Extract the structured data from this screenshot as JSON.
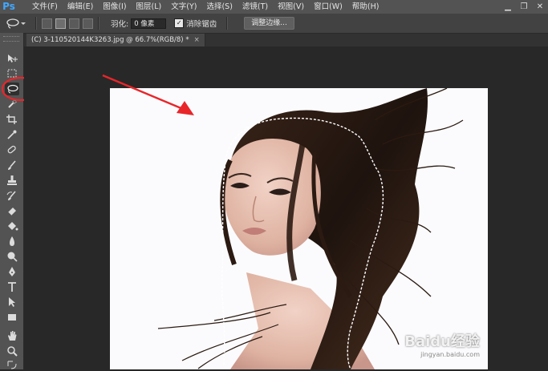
{
  "app": {
    "logo": "Ps"
  },
  "menu": [
    "文件(F)",
    "编辑(E)",
    "图像(I)",
    "图层(L)",
    "文字(Y)",
    "选择(S)",
    "滤镜(T)",
    "视图(V)",
    "窗口(W)",
    "帮助(H)"
  ],
  "options": {
    "feather_label": "羽化:",
    "feather_value": "0 像素",
    "antialias_label": "消除锯齿",
    "antialias_checked": true,
    "refine_button": "调整边缘..."
  },
  "document": {
    "tab_title": "(C) 3-110520144K3263.jpg @ 66.7%(RGB/8) *",
    "close": "×"
  },
  "tools": [
    "move-tool",
    "marquee-tool",
    "lasso-tool",
    "quick-select-tool",
    "crop-tool",
    "eyedropper-tool",
    "spot-heal-tool",
    "brush-tool",
    "clone-stamp-tool",
    "history-brush-tool",
    "eraser-tool",
    "paint-bucket-tool",
    "blur-tool",
    "dodge-tool",
    "pen-tool",
    "type-tool",
    "path-select-tool",
    "rectangle-tool",
    "hand-tool",
    "zoom-tool"
  ],
  "active_tool": "lasso-tool",
  "watermark": {
    "main": "Baidu经验",
    "sub": "jingyan.baidu.com"
  },
  "colors": {
    "accent": "#41a7ff",
    "annotation_red": "#e8262a"
  }
}
